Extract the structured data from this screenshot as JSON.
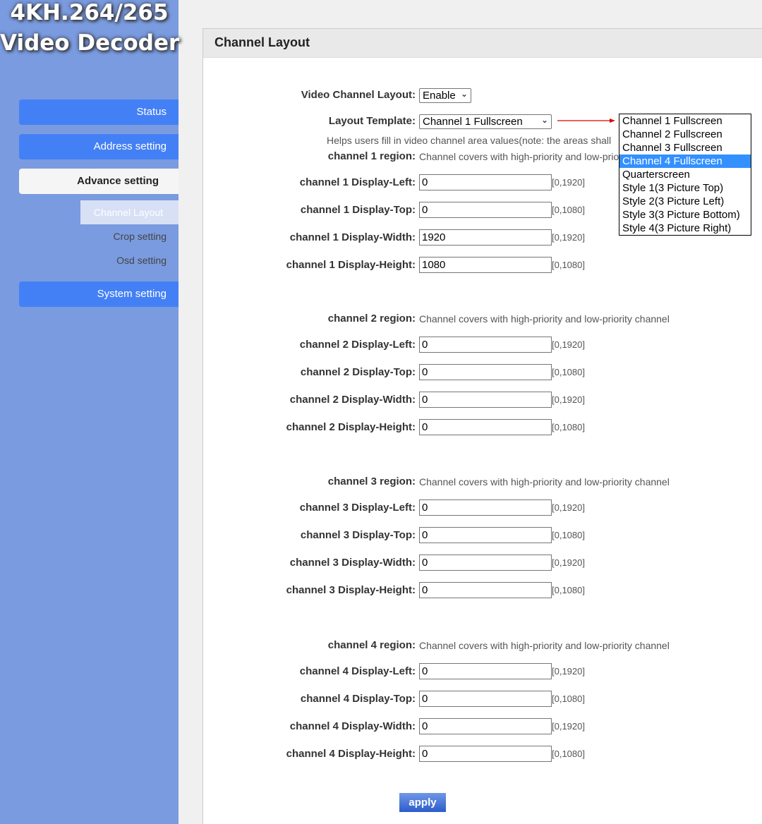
{
  "logo": {
    "line1": "4KH.264/265",
    "line2": "Video Decoder"
  },
  "sidebar": {
    "items": [
      {
        "label": "Status"
      },
      {
        "label": "Address setting"
      },
      {
        "label": "Advance setting"
      },
      {
        "label": "System setting"
      }
    ],
    "subitems": [
      {
        "label": "Channel Layout"
      },
      {
        "label": "Crop setting"
      },
      {
        "label": "Osd setting"
      }
    ]
  },
  "panel": {
    "title": "Channel Layout"
  },
  "form": {
    "video_layout_label": "Video Channel Layout:",
    "video_layout_value": "Enable",
    "template_label": "Layout Template:",
    "template_value": "Channel 1 Fullscreen",
    "help_text": "Helps users fill in video channel area values(note: the areas shall",
    "template_options": [
      "Channel 1 Fullscreen",
      "Channel 2 Fullscreen",
      "Channel 3 Fullscreen",
      "Channel 4 Fullscreen",
      "Quarterscreen",
      "Style 1(3 Picture Top)",
      "Style 2(3 Picture Left)",
      "Style 3(3 Picture Bottom)",
      "Style 4(3 Picture Right)"
    ],
    "highlighted_option": "Channel 4 Fullscreen",
    "arrow_color": "#e00000"
  },
  "channels": [
    {
      "region_label": "channel 1 region:",
      "region_text": "Channel covers with high-priority and low-priority channel",
      "fields": [
        {
          "label": "channel 1 Display-Left:",
          "value": "0",
          "range": "[0,1920]"
        },
        {
          "label": "channel 1 Display-Top:",
          "value": "0",
          "range": "[0,1080]"
        },
        {
          "label": "channel 1 Display-Width:",
          "value": "1920",
          "range": "[0,1920]"
        },
        {
          "label": "channel 1 Display-Height:",
          "value": "1080",
          "range": "[0,1080]"
        }
      ]
    },
    {
      "region_label": "channel 2 region:",
      "region_text": "Channel covers with high-priority and low-priority channel",
      "fields": [
        {
          "label": "channel 2 Display-Left:",
          "value": "0",
          "range": "[0,1920]"
        },
        {
          "label": "channel 2 Display-Top:",
          "value": "0",
          "range": "[0,1080]"
        },
        {
          "label": "channel 2 Display-Width:",
          "value": "0",
          "range": "[0,1920]"
        },
        {
          "label": "channel 2 Display-Height:",
          "value": "0",
          "range": "[0,1080]"
        }
      ]
    },
    {
      "region_label": "channel 3 region:",
      "region_text": "Channel covers with high-priority and low-priority channel",
      "fields": [
        {
          "label": "channel 3 Display-Left:",
          "value": "0",
          "range": "[0,1920]"
        },
        {
          "label": "channel 3 Display-Top:",
          "value": "0",
          "range": "[0,1080]"
        },
        {
          "label": "channel 3 Display-Width:",
          "value": "0",
          "range": "[0,1920]"
        },
        {
          "label": "channel 3 Display-Height:",
          "value": "0",
          "range": "[0,1080]"
        }
      ]
    },
    {
      "region_label": "channel 4 region:",
      "region_text": "Channel covers with high-priority and low-priority channel",
      "fields": [
        {
          "label": "channel 4 Display-Left:",
          "value": "0",
          "range": "[0,1920]"
        },
        {
          "label": "channel 4 Display-Top:",
          "value": "0",
          "range": "[0,1080]"
        },
        {
          "label": "channel 4 Display-Width:",
          "value": "0",
          "range": "[0,1920]"
        },
        {
          "label": "channel 4 Display-Height:",
          "value": "0",
          "range": "[0,1080]"
        }
      ]
    }
  ],
  "apply_label": "apply"
}
